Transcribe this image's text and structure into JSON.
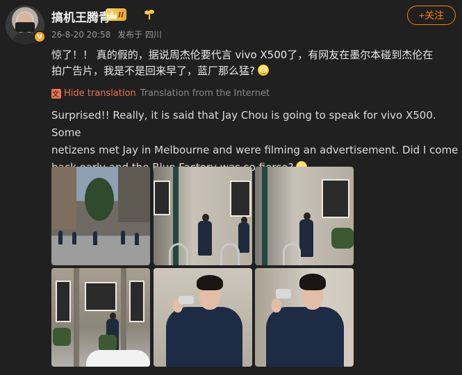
{
  "user": {
    "name": "搞机王腾青",
    "level": "II",
    "verified_mark": "V"
  },
  "meta": {
    "timestamp": "26-8-20 20:58",
    "location": "发布于 四川"
  },
  "follow_label": "+关注",
  "post": {
    "text_line1": "惊了！！ 真的假的，据说周杰伦要代言 vivo X500了，有网友在墨尔本碰到杰伦在",
    "text_line2": "拍广告片，我是不是回来早了，蓝厂那么猛?"
  },
  "translation": {
    "hide_label": "Hide translation",
    "source_label": "Translation from the Internet",
    "line1": "Surprised!! Really, it is said that Jay Chou is going to speak for vivo X500. Some",
    "line2": "netizens met Jay in Melbourne and were filming an advertisement. Did I come",
    "line3": "back early and the Blue Factory was so fierce?"
  },
  "icons": {
    "avatar": "avatar",
    "level_badge": "crown-icon",
    "sprout": "sprout-icon",
    "translate": "translate-icon",
    "emoji": "smile-emoji-icon"
  },
  "colors": {
    "accent": "#ff8200",
    "link": "#eb7350",
    "background": "#202020"
  },
  "photos": [
    {
      "name": "street-crowd-photo"
    },
    {
      "name": "building-man-photo"
    },
    {
      "name": "building-man-phone-photo"
    },
    {
      "name": "arched-building-photo"
    },
    {
      "name": "man-phone-closeup-photo"
    },
    {
      "name": "man-phone-closeup-photo-2"
    }
  ]
}
